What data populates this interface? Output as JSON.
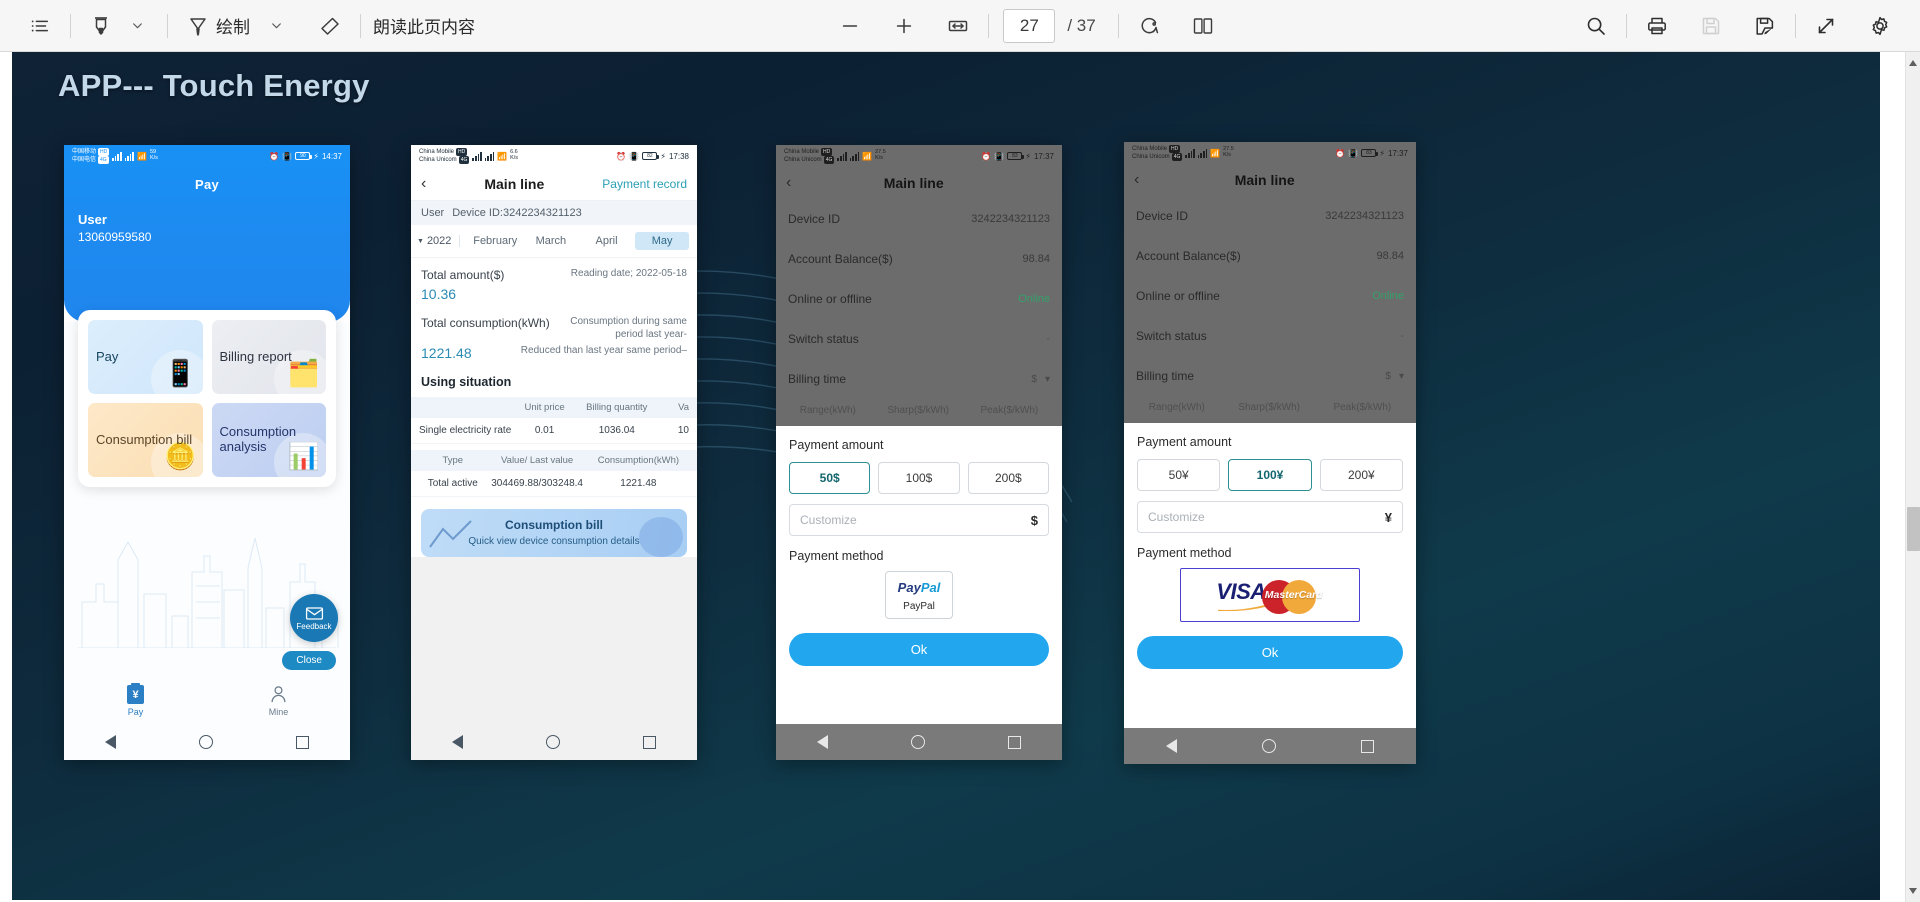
{
  "toolbar": {
    "icons": {
      "outline": "outline-list-icon",
      "highlighter": "highlighter-pen-icon",
      "pen": "pen-draw-icon",
      "eraser": "eraser-icon",
      "zoom_out": "minus-icon",
      "zoom_in": "plus-icon",
      "fit_width": "fit-width-icon",
      "rotate": "rotate-icon",
      "dual_page": "dual-page-icon",
      "search": "search-icon",
      "print": "print-icon",
      "save": "save-icon",
      "save_as": "save-as-icon",
      "fullscreen": "fullscreen-icon",
      "settings": "gear-icon"
    },
    "draw_label": "绘制",
    "read_aloud_label": "朗读此页内容",
    "chevron": "⌄",
    "page_current": "27",
    "page_total": "/ 37"
  },
  "slide": {
    "title": "APP--- Touch Energy"
  },
  "phone1": {
    "status": {
      "carrier1": "中国移动",
      "carrier1_tag": "HD",
      "carrier2": "中国电信",
      "carrier2_tag": "4G",
      "speed": "59",
      "speed_unit": "K/s",
      "battery": "90",
      "time": "14:37"
    },
    "title": "Pay",
    "user_label": "User",
    "phone_number": "13060959580",
    "tiles": [
      {
        "label": "Pay",
        "emoji": "📱"
      },
      {
        "label": "Billing report",
        "emoji": "🗂️"
      },
      {
        "label": "Consumption bill",
        "emoji": "🪙"
      },
      {
        "label": "Consumption analysis",
        "emoji": "📊"
      }
    ],
    "feedback_label": "Feedback",
    "close_label": "Close",
    "tabs": [
      {
        "label": "Pay",
        "icon": "yen-clipboard-icon",
        "glyph": "¥"
      },
      {
        "label": "Mine",
        "icon": "person-icon"
      }
    ]
  },
  "phone2": {
    "status": {
      "carrier1": "China Mobile",
      "carrier1_tag": "HD",
      "carrier2": "China Unicom",
      "carrier2_tag": "4G",
      "speed": "6.6",
      "speed_unit": "K/s",
      "battery": "82",
      "time": "17:38"
    },
    "title": "Main line",
    "payment_record": "Payment record",
    "user_label": "User",
    "device_id": "Device ID:3242234321123",
    "year": "2022",
    "months": [
      "February",
      "March",
      "April",
      "May"
    ],
    "active_month": "May",
    "total_amount_label": "Total amount($)",
    "reading_date_label": "Reading date;",
    "reading_date": "2022-05-18",
    "total_amount": "10.36",
    "total_consumption_label": "Total consumption(kWh)",
    "last_year_note": "Consumption during same period last year-",
    "reduced_note": "Reduced than last year same period–",
    "total_consumption": "1221.48",
    "using_situation": "Using situation",
    "table1": {
      "headers": [
        "",
        "Unit price",
        "Billing quantity",
        "Va"
      ],
      "rows": [
        [
          "Single electricity rate",
          "0.01",
          "1036.04",
          "10"
        ]
      ]
    },
    "table2": {
      "headers": [
        "Type",
        "Value/ Last value",
        "Consumption(kWh)"
      ],
      "rows": [
        [
          "Total active",
          "304469.88/303248.4",
          "1221.48"
        ]
      ]
    },
    "banner_title": "Consumption bill",
    "banner_sub": "Quick view device consumption details"
  },
  "phone3": {
    "status": {
      "carrier1": "China Mobile",
      "carrier1_tag": "HD",
      "carrier2": "China Unicom",
      "carrier2_tag": "4G",
      "speed": "27.5",
      "speed_unit": "K/s",
      "battery": "83",
      "time": "17:37"
    },
    "title": "Main line",
    "rows": [
      {
        "label": "Device ID",
        "value": "3242234321123",
        "state": ""
      },
      {
        "label": "Account Balance($)",
        "value": "98.84",
        "state": ""
      },
      {
        "label": "Online or offline",
        "value": "Online",
        "state": "online"
      },
      {
        "label": "Switch status",
        "value": "-",
        "state": "dash"
      },
      {
        "label": "Billing time",
        "value": "",
        "state": ""
      }
    ],
    "rate_headers": [
      "Range(kWh)",
      "Sharp($/kWh)",
      "Peak($/kWh)"
    ],
    "modal": {
      "amount_label": "Payment amount",
      "amounts": [
        "50$",
        "100$",
        "200$"
      ],
      "selected_amount": "50$",
      "customize_placeholder": "Customize",
      "currency": "$",
      "customize_value": "",
      "method_label": "Payment method",
      "method_name": "PayPal",
      "method_logo_1": "Pay",
      "method_logo_2": "Pal",
      "ok_label": "Ok"
    }
  },
  "phone4": {
    "status": {
      "carrier1": "China Mobile",
      "carrier1_tag": "HD",
      "carrier2": "China Unicom",
      "carrier2_tag": "4G",
      "speed": "27.5",
      "speed_unit": "K/s",
      "battery": "83",
      "time": "17:37"
    },
    "title": "Main line",
    "rows": [
      {
        "label": "Device ID",
        "value": "3242234321123",
        "state": ""
      },
      {
        "label": "Account Balance($)",
        "value": "98.84",
        "state": ""
      },
      {
        "label": "Online or offline",
        "value": "Online",
        "state": "online"
      },
      {
        "label": "Switch status",
        "value": "-",
        "state": "dash"
      },
      {
        "label": "Billing time",
        "value": "",
        "state": ""
      }
    ],
    "rate_headers": [
      "Range(kWh)",
      "Sharp($/kWh)",
      "Peak($/kWh)"
    ],
    "modal": {
      "amount_label": "Payment amount",
      "amounts": [
        "50¥",
        "100¥",
        "200¥"
      ],
      "selected_amount": "100¥",
      "customize_placeholder": "Customize",
      "currency": "¥",
      "customize_value": "",
      "method_label": "Payment method",
      "visa_text": "VISA",
      "mastercard_text": "MasterCard",
      "ok_label": "Ok"
    }
  },
  "colors": {
    "accent_blue": "#22a7ef",
    "page_bg": "#0e2436",
    "title_text": "#c3d9ea",
    "online_green": "#35a06a",
    "selected_teal": "#13666e",
    "visa_navy": "#1a1f71",
    "mc_red": "#cc2229",
    "mc_yellow": "#f2a93b"
  }
}
